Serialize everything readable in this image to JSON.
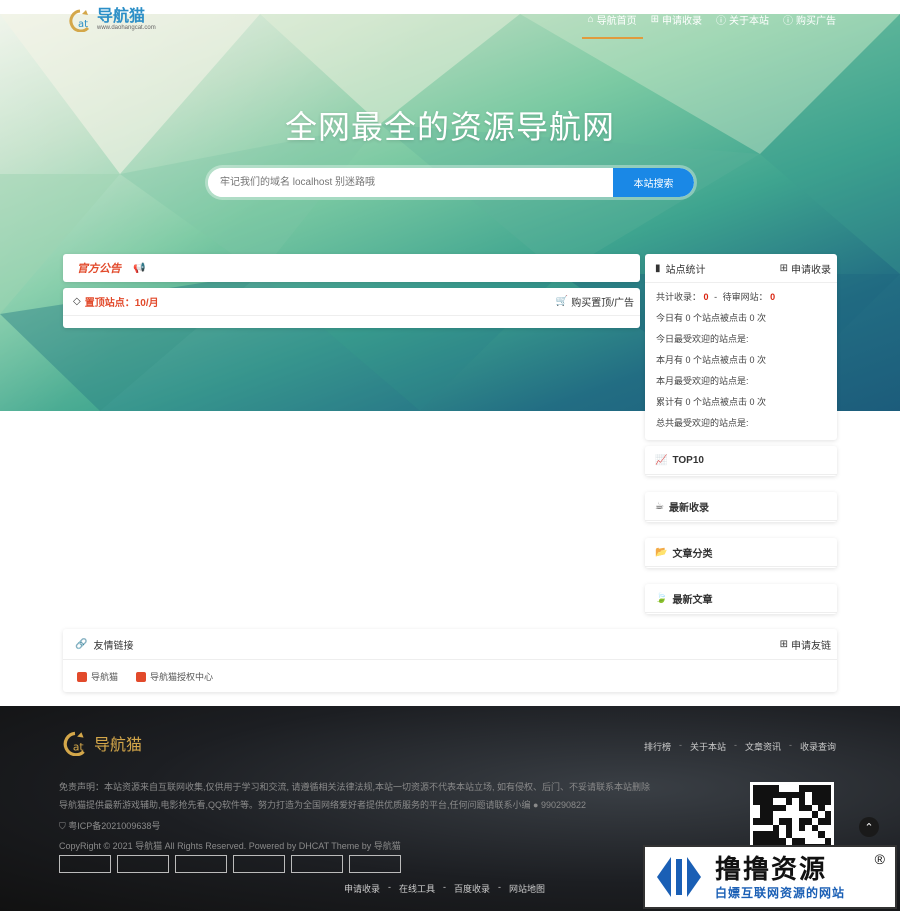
{
  "header": {
    "logo_text": "导航猫",
    "logo_sub": "www.daohangcat.com",
    "nav": [
      {
        "label": "导航首页",
        "icon": "home-icon",
        "active": true
      },
      {
        "label": "申请收录",
        "icon": "plus-square-icon",
        "active": false
      },
      {
        "label": "关于本站",
        "icon": "info-icon",
        "active": false
      },
      {
        "label": "购买广告",
        "icon": "info-icon",
        "active": false
      }
    ]
  },
  "hero": {
    "title": "全网最全的资源导航网",
    "search_placeholder": "牢记我们的域名 localhost 别迷路哦",
    "search_button": "本站搜索"
  },
  "notice": {
    "title": "官方公告",
    "icon": "megaphone-icon"
  },
  "pinned": {
    "title": "置顶站点：10/月",
    "action": "购买置顶/广告"
  },
  "stats": {
    "title": "站点统计",
    "action": "申请收录",
    "total_label": "共计收录：",
    "total_value": "0",
    "dash": "-",
    "pending_label": "待审网站：",
    "pending_value": "0",
    "lines": [
      "今日有 0 个站点被点击 0 次",
      "今日最受欢迎的站点是:",
      "本月有 0 个站点被点击 0 次",
      "本月最受欢迎的站点是:",
      "累计有 0 个站点被点击 0 次",
      "总共最受欢迎的站点是:"
    ]
  },
  "side_cards": [
    {
      "title": "TOP10",
      "icon": "trend-icon"
    },
    {
      "title": "最新收录",
      "icon": "coffee-icon"
    },
    {
      "title": "文章分类",
      "icon": "folder-icon"
    },
    {
      "title": "最新文章",
      "icon": "leaf-icon"
    }
  ],
  "friends": {
    "title": "友情链接",
    "action": "申请友链",
    "links": [
      "导航猫",
      "导航猫授权中心"
    ]
  },
  "footer": {
    "logo_text": "导航猫",
    "nav": [
      "排行榜",
      "关于本站",
      "文章资讯",
      "收录查询"
    ],
    "disclaimer": "免责声明：本站资源来自互联网收集,仅供用于学习和交流, 请遵循相关法律法规,本站一切资源不代表本站立场, 如有侵权、后门、不妥请联系本站删除",
    "intro": "导航猫提供最新游戏辅助,电影抢先看,QQ软件等。努力打造为全国网络爱好者提供优质服务的平台,任何问题请联系小编",
    "qq": "990290822",
    "icp": "粤ICP备2021009638号",
    "copyright": "CopyRight © 2021 导航猫 All Rights Reserved. Powered by DHCAT Theme by 导航猫",
    "bottom_nav": [
      "申请收录",
      "在线工具",
      "百度收录",
      "网站地图"
    ]
  },
  "watermark": {
    "title": "撸撸资源",
    "sub": "白嫖互联网资源的网站",
    "reg": "®"
  }
}
